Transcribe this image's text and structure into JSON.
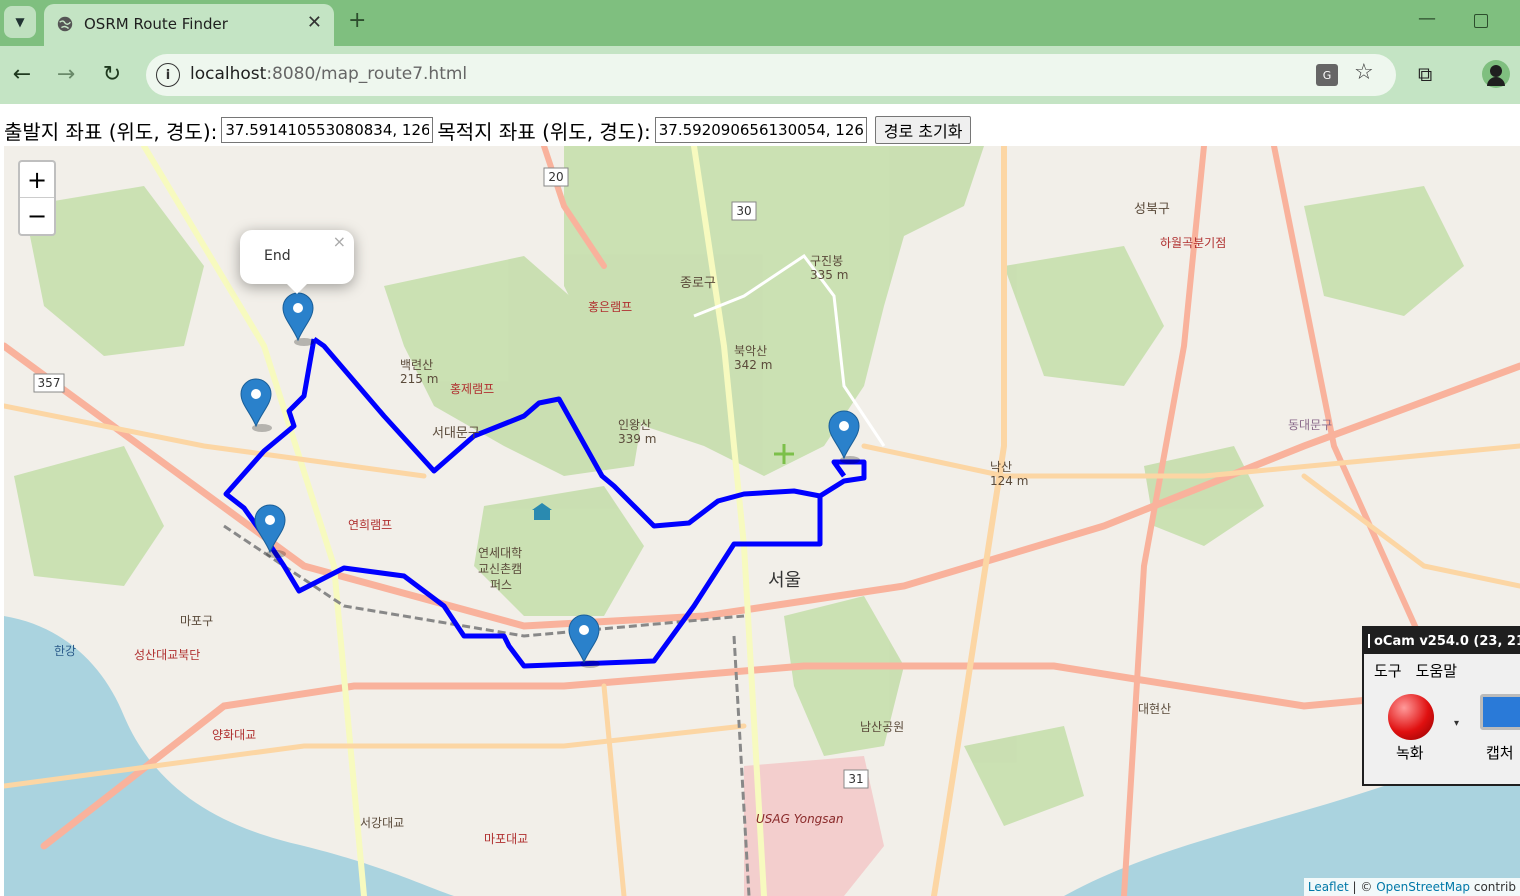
{
  "browser": {
    "tab_title": "OSRM Route Finder",
    "url_host": "localhost",
    "url_rest": ":8080/map_route7.html"
  },
  "controls": {
    "start_label": "출발지 좌표 (위도, 경도):",
    "start_value": "37.591410553080834, 126.",
    "dest_label": "목적지 좌표 (위도, 경도):",
    "dest_value": "37.592090656130054, 126.",
    "reset_button": "경로 초기화"
  },
  "map": {
    "zoom_in": "+",
    "zoom_out": "−",
    "popup_text": "End",
    "popup_close": "×",
    "route_color": "#0000ff",
    "marker_color": "#2a81cb",
    "labels": {
      "seoul": "서울",
      "seodaemun": "서대문구",
      "jongno": "종로구",
      "seongbuk": "성북구",
      "inwangsan": "인왕산",
      "inwangsan_h": "339 m",
      "bugaksan": "북악산",
      "bugaksan_h": "342 m",
      "gujibong": "구진봉",
      "gujibong_h": "335 m",
      "naksan": "낙산",
      "naksan_h": "124 m",
      "baekryeonsan": "백련산",
      "baekryeonsan_h": "215 m",
      "yonsei": "연세대학",
      "yonsei2": "교신촌캠",
      "yonsei3": "퍼스",
      "mapo": "마포구",
      "hangang": "한강",
      "namsan": "남산공원",
      "yongsan": "USAG Yongsan",
      "hongje_ramp": "홍제램프",
      "hongeun_ramp": "홍은램프",
      "yeonhui_ramp": "연희램프",
      "seongsan_jc": "성산대교북단",
      "seogang": "서강대교",
      "mapo_bridge": "마포대교",
      "yanghwa": "양화대교",
      "hajiwol": "하월곡분기점",
      "daehyunsan": "대현산",
      "dongdaemun": "동대문구",
      "r20": "20",
      "r30": "30",
      "r357": "357",
      "r31": "31"
    },
    "attribution_leaflet": "Leaflet",
    "attribution_sep": " | © ",
    "attribution_osm": "OpenStreetMap",
    "attribution_tail": " contrib"
  },
  "ocam": {
    "title": "oCam v254.0 (23, 21",
    "menu_tools": "도구",
    "menu_help": "도움말",
    "record_label": "녹화",
    "capture_label": "캡처"
  }
}
